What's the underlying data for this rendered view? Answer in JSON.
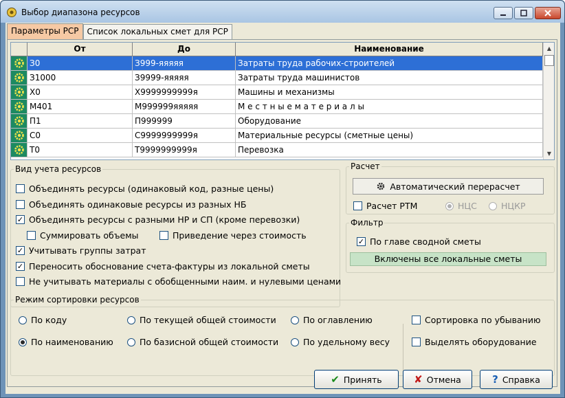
{
  "window": {
    "title": "Выбор диапазона ресурсов"
  },
  "tabs": [
    {
      "label": "Параметры РСР",
      "active": true
    },
    {
      "label": "Список локальных смет для РСР",
      "active": false
    }
  ],
  "grid": {
    "columns": [
      "",
      "От",
      "До",
      "Наименование"
    ],
    "rows": [
      {
        "from": "З0",
        "to": "З999-яяяяя",
        "name": "Затраты труда рабочих-строителей",
        "selected": true
      },
      {
        "from": "З1000",
        "to": "З9999-яяяяя",
        "name": "Затраты труда машинистов",
        "selected": false
      },
      {
        "from": "Х0",
        "to": "Х9999999999я",
        "name": "Машины и механизмы",
        "selected": false
      },
      {
        "from": "М401",
        "to": "М999999яяяяя",
        "name": "М е с т н ы е   м а т е р и а л ы",
        "selected": false
      },
      {
        "from": "П1",
        "to": "П999999",
        "name": "Оборудование",
        "selected": false
      },
      {
        "from": "С0",
        "to": "С9999999999я",
        "name": "Материальные ресурсы (сметные цены)",
        "selected": false
      },
      {
        "from": "Т0",
        "to": "Т9999999999я",
        "name": "Перевозка",
        "selected": false
      }
    ],
    "row_icon": "resource-gear-icon"
  },
  "resource_mode": {
    "legend": "Вид учета ресурсов",
    "options": [
      {
        "label": "Объединять ресурсы (одинаковый код, разные цены)",
        "checked": false
      },
      {
        "label": "Объединять одинаковые ресурсы из разных НБ",
        "checked": false
      },
      {
        "label": "Объединять ресурсы с разными НР и СП (кроме перевозки)",
        "checked": true
      },
      {
        "label": "Суммировать объемы",
        "checked": false
      },
      {
        "label": "Приведение через стоимость",
        "checked": false
      },
      {
        "label": "Учитывать группы затрат",
        "checked": true
      },
      {
        "label": "Переносить обоснование счета-фактуры из локальной сметы",
        "checked": true
      },
      {
        "label": "Не учитывать материалы с обобщенными наим. и нулевыми ценами",
        "checked": false
      }
    ]
  },
  "calc": {
    "legend": "Расчет",
    "auto_button": "Автоматический перерасчет",
    "rtm_label": "Расчет РТМ",
    "rtm_checked": false,
    "nds_label": "НЦС",
    "nckr_label": "НЦКР"
  },
  "filter": {
    "legend": "Фильтр",
    "chapter_label": "По главе сводной сметы",
    "chapter_checked": true,
    "included_text": "Включены все локальные сметы"
  },
  "sort": {
    "legend": "Режим сортировки ресурсов",
    "options": [
      "По коду",
      "По текущей общей стоимости",
      "По оглавлению",
      "По наименованию",
      "По базисной общей стоимости",
      "По удельному весу"
    ],
    "selected": "По наименованию",
    "desc_label": "Сортировка по убыванию",
    "desc_checked": false,
    "equip_label": "Выделять оборудование",
    "equip_checked": false
  },
  "buttons": {
    "accept": "Принять",
    "cancel": "Отмена",
    "help": "Справка"
  },
  "colors": {
    "selection": "#2d6fd6",
    "icon_bg": "#1d8a62",
    "included_bg": "#c7e3c7"
  }
}
